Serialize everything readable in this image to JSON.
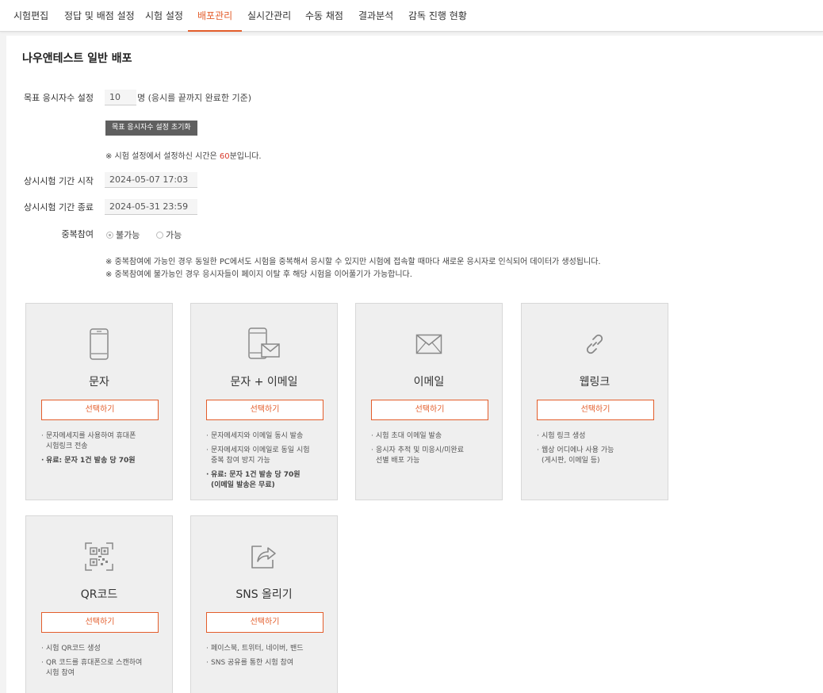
{
  "tabs": [
    {
      "label": "시험편집"
    },
    {
      "label": "정답 및 배점 설정"
    },
    {
      "label": "시험 설정"
    },
    {
      "label": "배포관리"
    },
    {
      "label": "실시간관리"
    },
    {
      "label": "수동 채점"
    },
    {
      "label": "결과분석"
    },
    {
      "label": "감독 진행 현황"
    }
  ],
  "active_tab": "배포관리",
  "page_title": "나우앤테스트 일반 배포",
  "form": {
    "target_label": "목표 응시자수 설정",
    "target_value": "10",
    "target_suffix": "명 (응시를 끝까지 완료한 기준)",
    "reset_label": "목표 응시자수 설정 초기화",
    "time_note_prefix": "※ 시험 설정에서 설정하신 시간은 ",
    "time_note_value": "60",
    "time_note_suffix": "분입니다.",
    "start_label": "상시시험 기간 시작",
    "start_value": "2024-05-07 17:03",
    "end_label": "상시시험 기간 종료",
    "end_value": "2024-05-31 23:59",
    "dup_label": "중복참여",
    "dup_option_no": "불가능",
    "dup_option_yes": "가능",
    "dup_selected": "불가능",
    "dup_note_1": "※ 중복참여에 가능인 경우 동일한 PC에서도 시험을 중복해서 응시할 수 있지만 시험에 접속할 때마다 새로운 응시자로 인식되어 데이터가 생성됩니다.",
    "dup_note_2": "※ 중복참여에 불가능인 경우 응시자들이 페이지 이탈 후 해당 시험을 이어풀기가 가능합니다."
  },
  "cards": [
    {
      "title": "문자",
      "icon": "smartphone-icon",
      "button": "선택하기",
      "bullets": [
        {
          "text": "문자메세지를 사용하여 휴대폰\n시험링크 전송",
          "bold": false
        },
        {
          "text": "유료: 문자 1건 발송 당 70원",
          "bold": true
        }
      ]
    },
    {
      "title": "문자 + 이메일",
      "icon": "phone-mail-icon",
      "button": "선택하기",
      "bullets": [
        {
          "text": "문자메세지와 이메일 동시 발송",
          "bold": false
        },
        {
          "text": "문자메세지와 이메일로 동일  시험\n중복 참여 방지 가능",
          "bold": false
        },
        {
          "text": "유료: 문자 1건 발송 당 70원\n(이메일 발송은 무료)",
          "bold": true
        }
      ]
    },
    {
      "title": "이메일",
      "icon": "envelope-icon",
      "button": "선택하기",
      "bullets": [
        {
          "text": "시험 초대 이메일 발송",
          "bold": false
        },
        {
          "text": "응시자 추적 및 미응시/미완료\n선별 배포 가능",
          "bold": false
        }
      ]
    },
    {
      "title": "웹링크",
      "icon": "link-icon",
      "button": "선택하기",
      "bullets": [
        {
          "text": "시험 링크 생성",
          "bold": false
        },
        {
          "text": "웹상 어디에나 사용 가능\n(게시판, 이메일 등)",
          "bold": false
        }
      ]
    },
    {
      "title": "QR코드",
      "icon": "qr-code-icon",
      "button": "선택하기",
      "bullets": [
        {
          "text": "시험 QR코드 생성",
          "bold": false
        },
        {
          "text": "QR 코드를 휴대폰으로 스캔하여\n시험 참여",
          "bold": false
        }
      ]
    },
    {
      "title": "SNS 올리기",
      "icon": "share-icon",
      "button": "선택하기",
      "bullets": [
        {
          "text": "페이스북, 트위터, 네이버, 밴드",
          "bold": false
        },
        {
          "text": "SNS 공유를 통한  시험 참여",
          "bold": false
        }
      ]
    }
  ],
  "colors": {
    "accent": "#e35d2b",
    "highlight": "#d8392b",
    "reset_button": "#5f5f5f"
  }
}
